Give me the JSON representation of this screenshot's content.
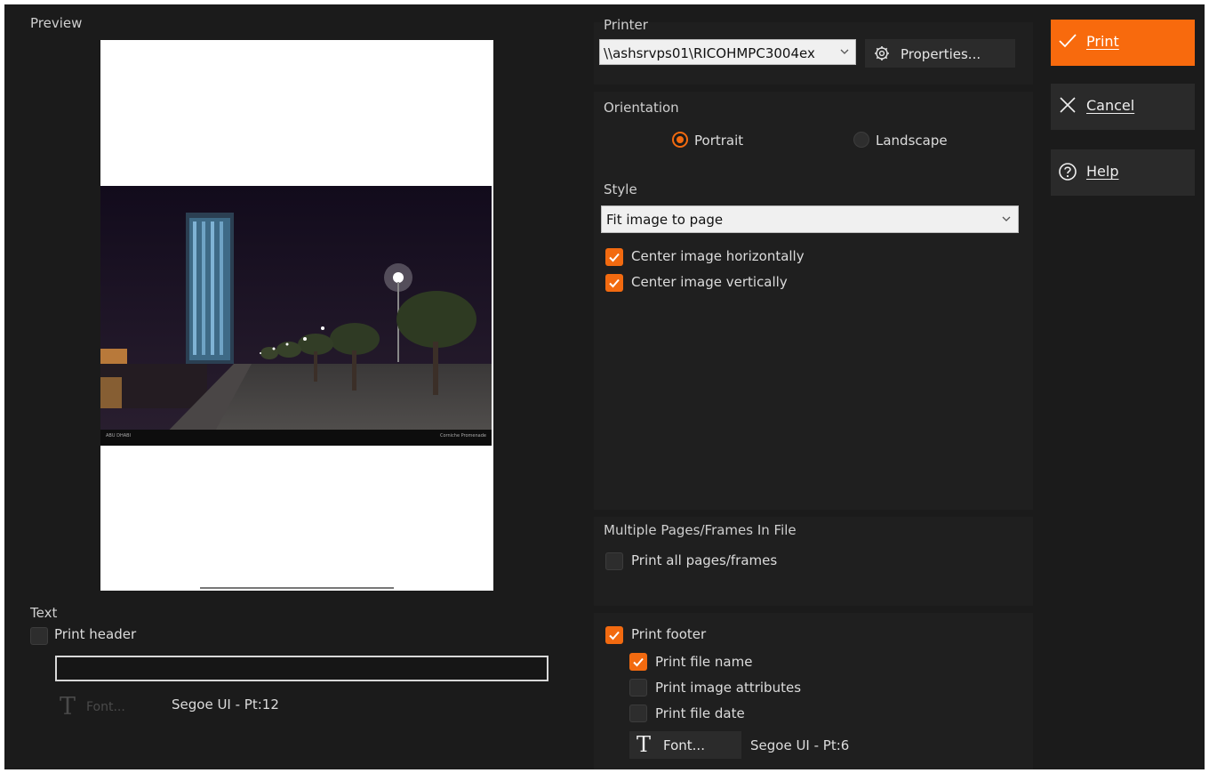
{
  "preview": {
    "label": "Preview",
    "photo_caption_left": "ABU DHABI",
    "photo_caption_right": "Corniche Promenade"
  },
  "printer": {
    "label": "Printer",
    "selected": "\\\\ashsrvps01\\RICOHMPC3004ex",
    "properties_label": "Properties..."
  },
  "orientation": {
    "label": "Orientation",
    "portrait_label": "Portrait",
    "landscape_label": "Landscape",
    "selected": "Portrait"
  },
  "style": {
    "label": "Style",
    "selected": "Fit image to page",
    "center_h_label": "Center image horizontally",
    "center_h_checked": true,
    "center_v_label": "Center image vertically",
    "center_v_checked": true
  },
  "multipage": {
    "label": "Multiple Pages/Frames In File",
    "print_all_label": "Print all pages/frames",
    "print_all_checked": false
  },
  "text": {
    "label": "Text",
    "print_header_label": "Print header",
    "print_header_checked": false,
    "header_value": "",
    "font_label": "Font...",
    "font_info": "Segoe UI - Pt:12"
  },
  "footer": {
    "print_footer_label": "Print footer",
    "print_footer_checked": true,
    "file_name_label": "Print file name",
    "file_name_checked": true,
    "image_attributes_label": "Print image attributes",
    "image_attributes_checked": false,
    "file_date_label": "Print file date",
    "file_date_checked": false,
    "font_label": "Font...",
    "font_info": "Segoe UI - Pt:6"
  },
  "actions": {
    "print_label": "Print",
    "cancel_label": "Cancel",
    "help_label": "Help"
  },
  "colors": {
    "accent": "#f86a0d",
    "background": "#1b1b1b",
    "panel": "#1f1f1f"
  }
}
